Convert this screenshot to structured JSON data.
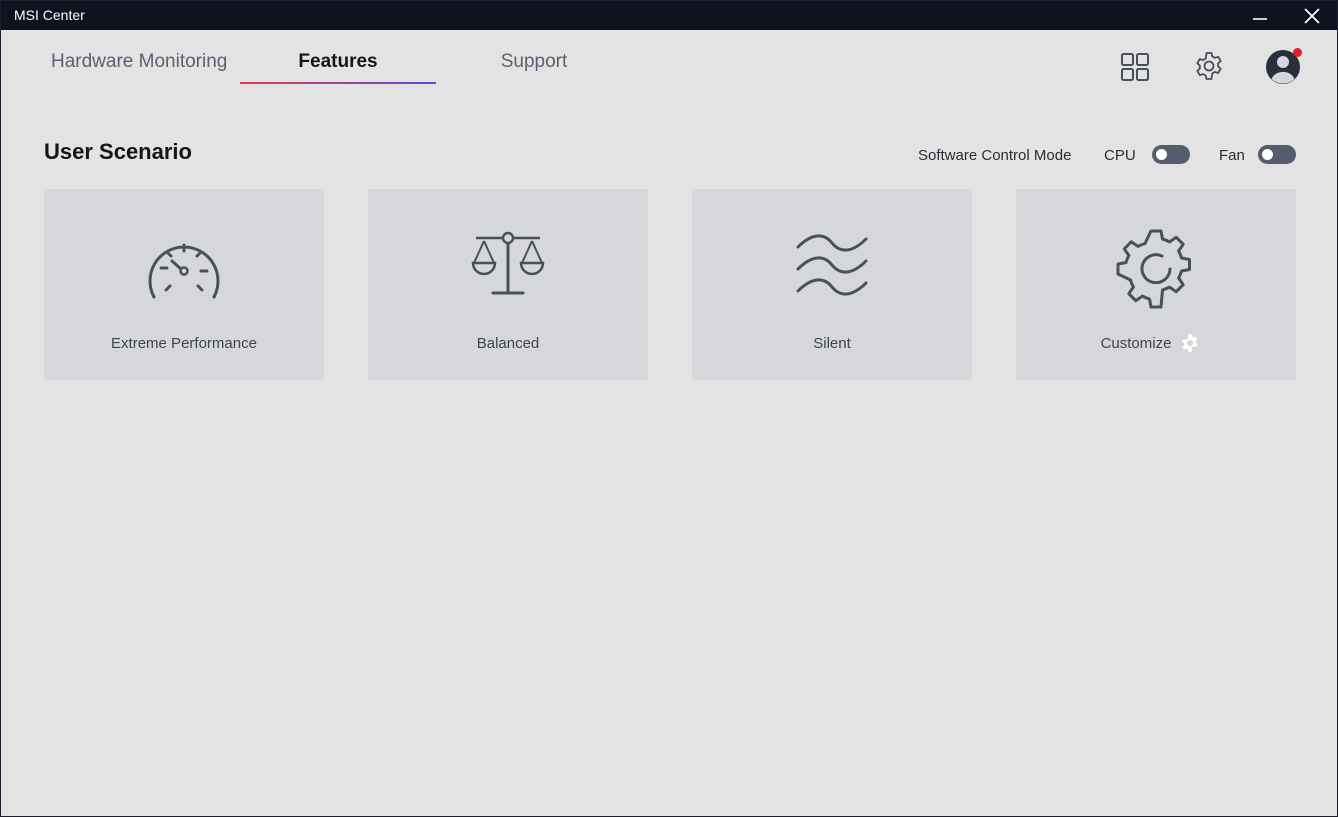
{
  "window": {
    "title": "MSI Center"
  },
  "tabs": [
    {
      "label": "Hardware Monitoring",
      "active": false
    },
    {
      "label": "Features",
      "active": true
    },
    {
      "label": "Support",
      "active": false
    }
  ],
  "header_icons": [
    "apps-grid-icon",
    "settings-gear-icon",
    "user-avatar-icon"
  ],
  "notification": {
    "color": "#e3202f"
  },
  "section": {
    "title": "User Scenario",
    "software_control_mode_label": "Software Control Mode",
    "cpu_label": "CPU",
    "fan_label": "Fan",
    "cpu_toggle_on": false,
    "fan_toggle_on": false
  },
  "scenarios": [
    {
      "label": "Extreme Performance",
      "icon": "speedometer-icon"
    },
    {
      "label": "Balanced",
      "icon": "balance-scale-icon"
    },
    {
      "label": "Silent",
      "icon": "waves-icon"
    },
    {
      "label": "Customize",
      "icon": "gear-icon"
    }
  ],
  "colors": {
    "titlebar": "#0e1320",
    "background": "#e3e3e3",
    "card": "#d6d7da",
    "toggle_off": "#565d6a",
    "tab_underline_start": "#e23b4a",
    "tab_underline_end": "#5b4ad8"
  }
}
